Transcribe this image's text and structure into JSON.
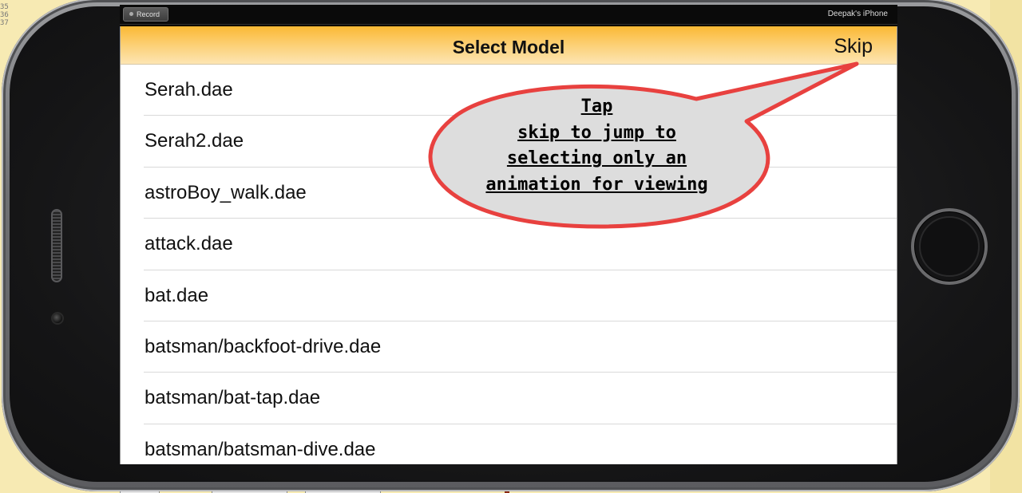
{
  "background": {
    "gutter_numbers": [
      "35",
      "36",
      "37"
    ]
  },
  "recorder": {
    "record_label": "Record",
    "device_name": "Deepak's iPhone"
  },
  "nav": {
    "title": "Select Model",
    "skip_label": "Skip",
    "accent_color": "#fbb934"
  },
  "models": [
    "Serah.dae",
    "Serah2.dae",
    "astroBoy_walk.dae",
    "attack.dae",
    "bat.dae",
    "batsman/backfoot-drive.dae",
    "batsman/bat-tap.dae",
    "batsman/batsman-dive.dae"
  ],
  "callout": {
    "lines": [
      "Tap",
      "skip to jump to",
      "selecting only an",
      "animation for viewing"
    ],
    "border_color": "#e8413f",
    "fill_color": "#dddddd"
  }
}
